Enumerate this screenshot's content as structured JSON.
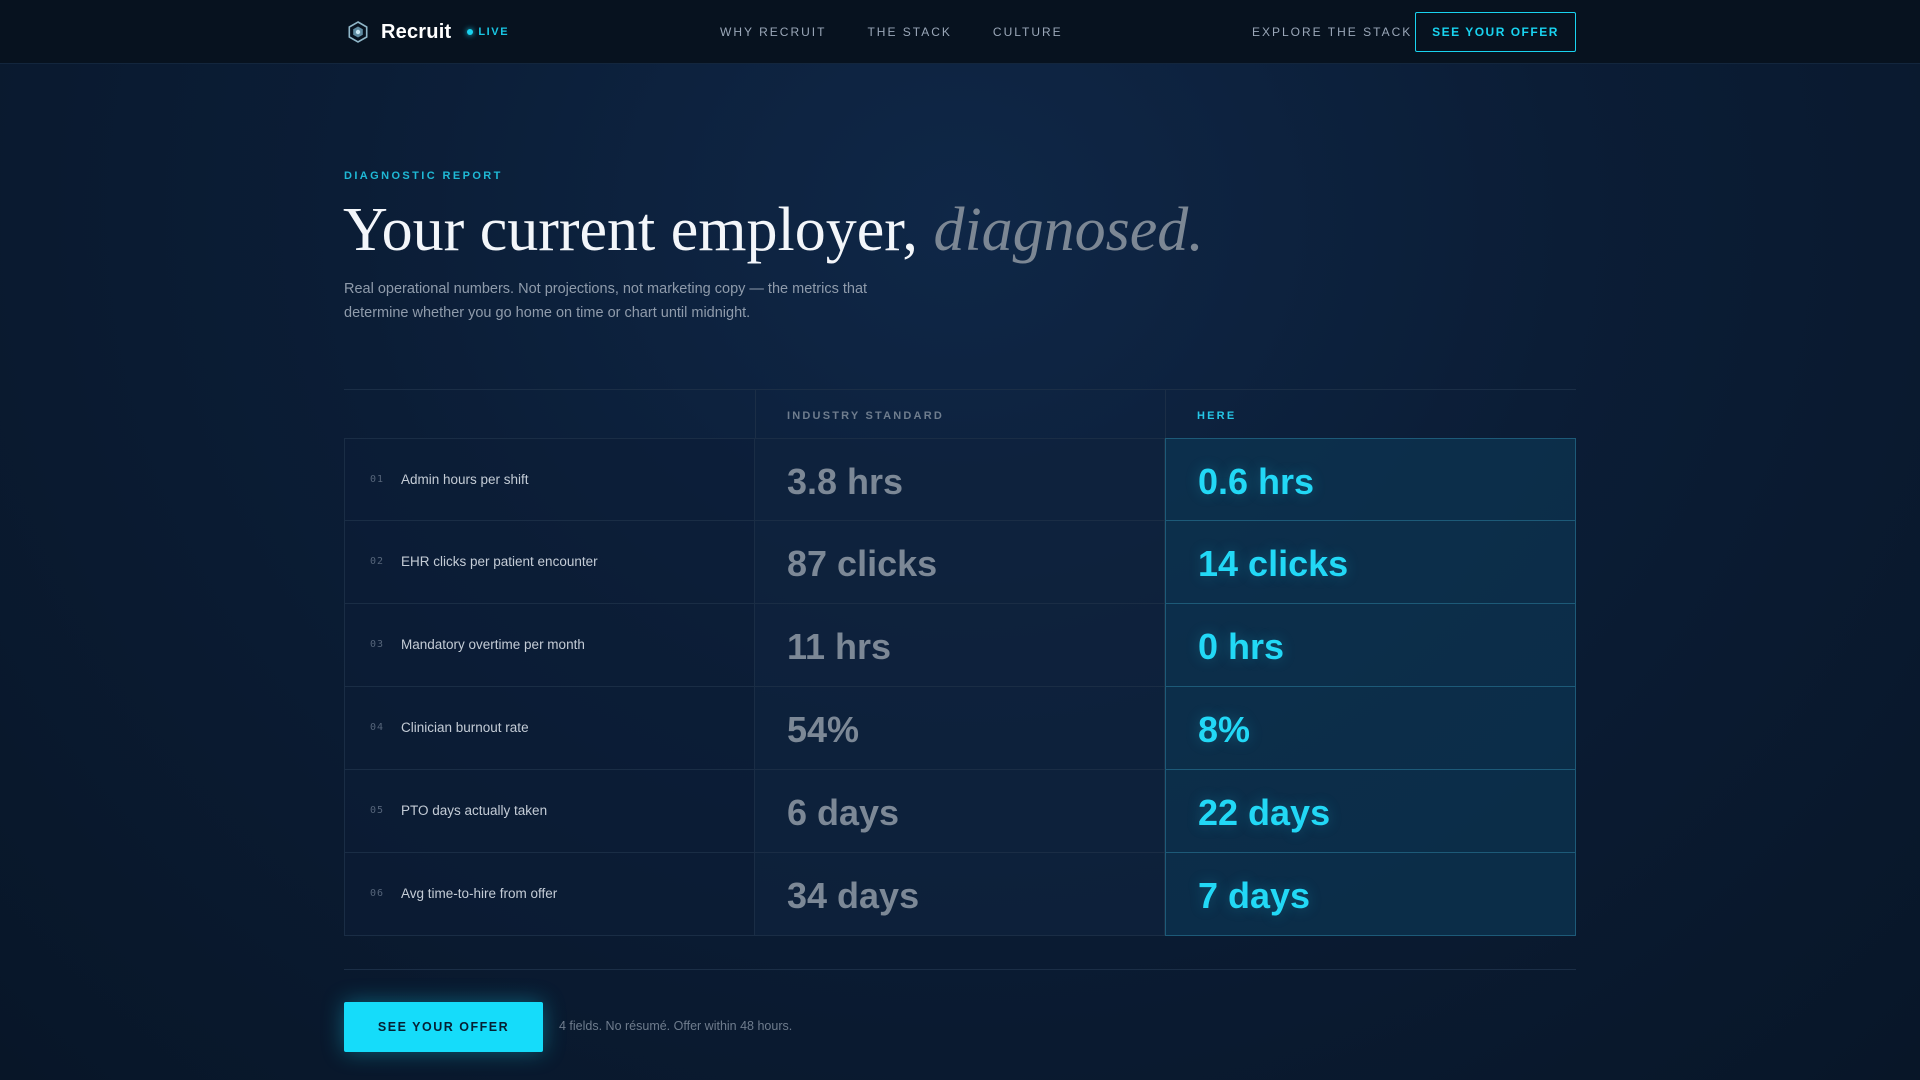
{
  "nav": {
    "brand": "Recruit",
    "live_label": "LIVE",
    "links": [
      "WHY RECRUIT",
      "THE STACK",
      "CULTURE"
    ],
    "explore_label": "EXPLORE THE STACK",
    "cta_label": "SEE YOUR OFFER"
  },
  "hero": {
    "eyebrow": "DIAGNOSTIC REPORT",
    "headline_main": "Your current employer,",
    "headline_accent": "diagnosed.",
    "subcopy": "Real operational numbers. Not projections, not marketing copy — the metrics that determine whether you go home on time or chart until midnight."
  },
  "table": {
    "col_standard": "INDUSTRY STANDARD",
    "col_here": "HERE",
    "rows": [
      {
        "num": "01",
        "label": "Admin hours per shift",
        "standard": "3.8 hrs",
        "here": "0.6 hrs"
      },
      {
        "num": "02",
        "label": "EHR clicks per patient encounter",
        "standard": "87 clicks",
        "here": "14 clicks"
      },
      {
        "num": "03",
        "label": "Mandatory overtime per month",
        "standard": "11 hrs",
        "here": "0 hrs"
      },
      {
        "num": "04",
        "label": "Clinician burnout rate",
        "standard": "54%",
        "here": "8%"
      },
      {
        "num": "05",
        "label": "PTO days actually taken",
        "standard": "6 days",
        "here": "22 days"
      },
      {
        "num": "06",
        "label": "Avg time-to-hire from offer",
        "standard": "34 days",
        "here": "7 days"
      }
    ]
  },
  "cta": {
    "label": "SEE YOUR OFFER",
    "note": "4 fields. No résumé. Offer within 48 hours."
  },
  "colors": {
    "accent": "#15dcfa",
    "background": "#0b1d36",
    "muted_value": "#7c8896"
  }
}
